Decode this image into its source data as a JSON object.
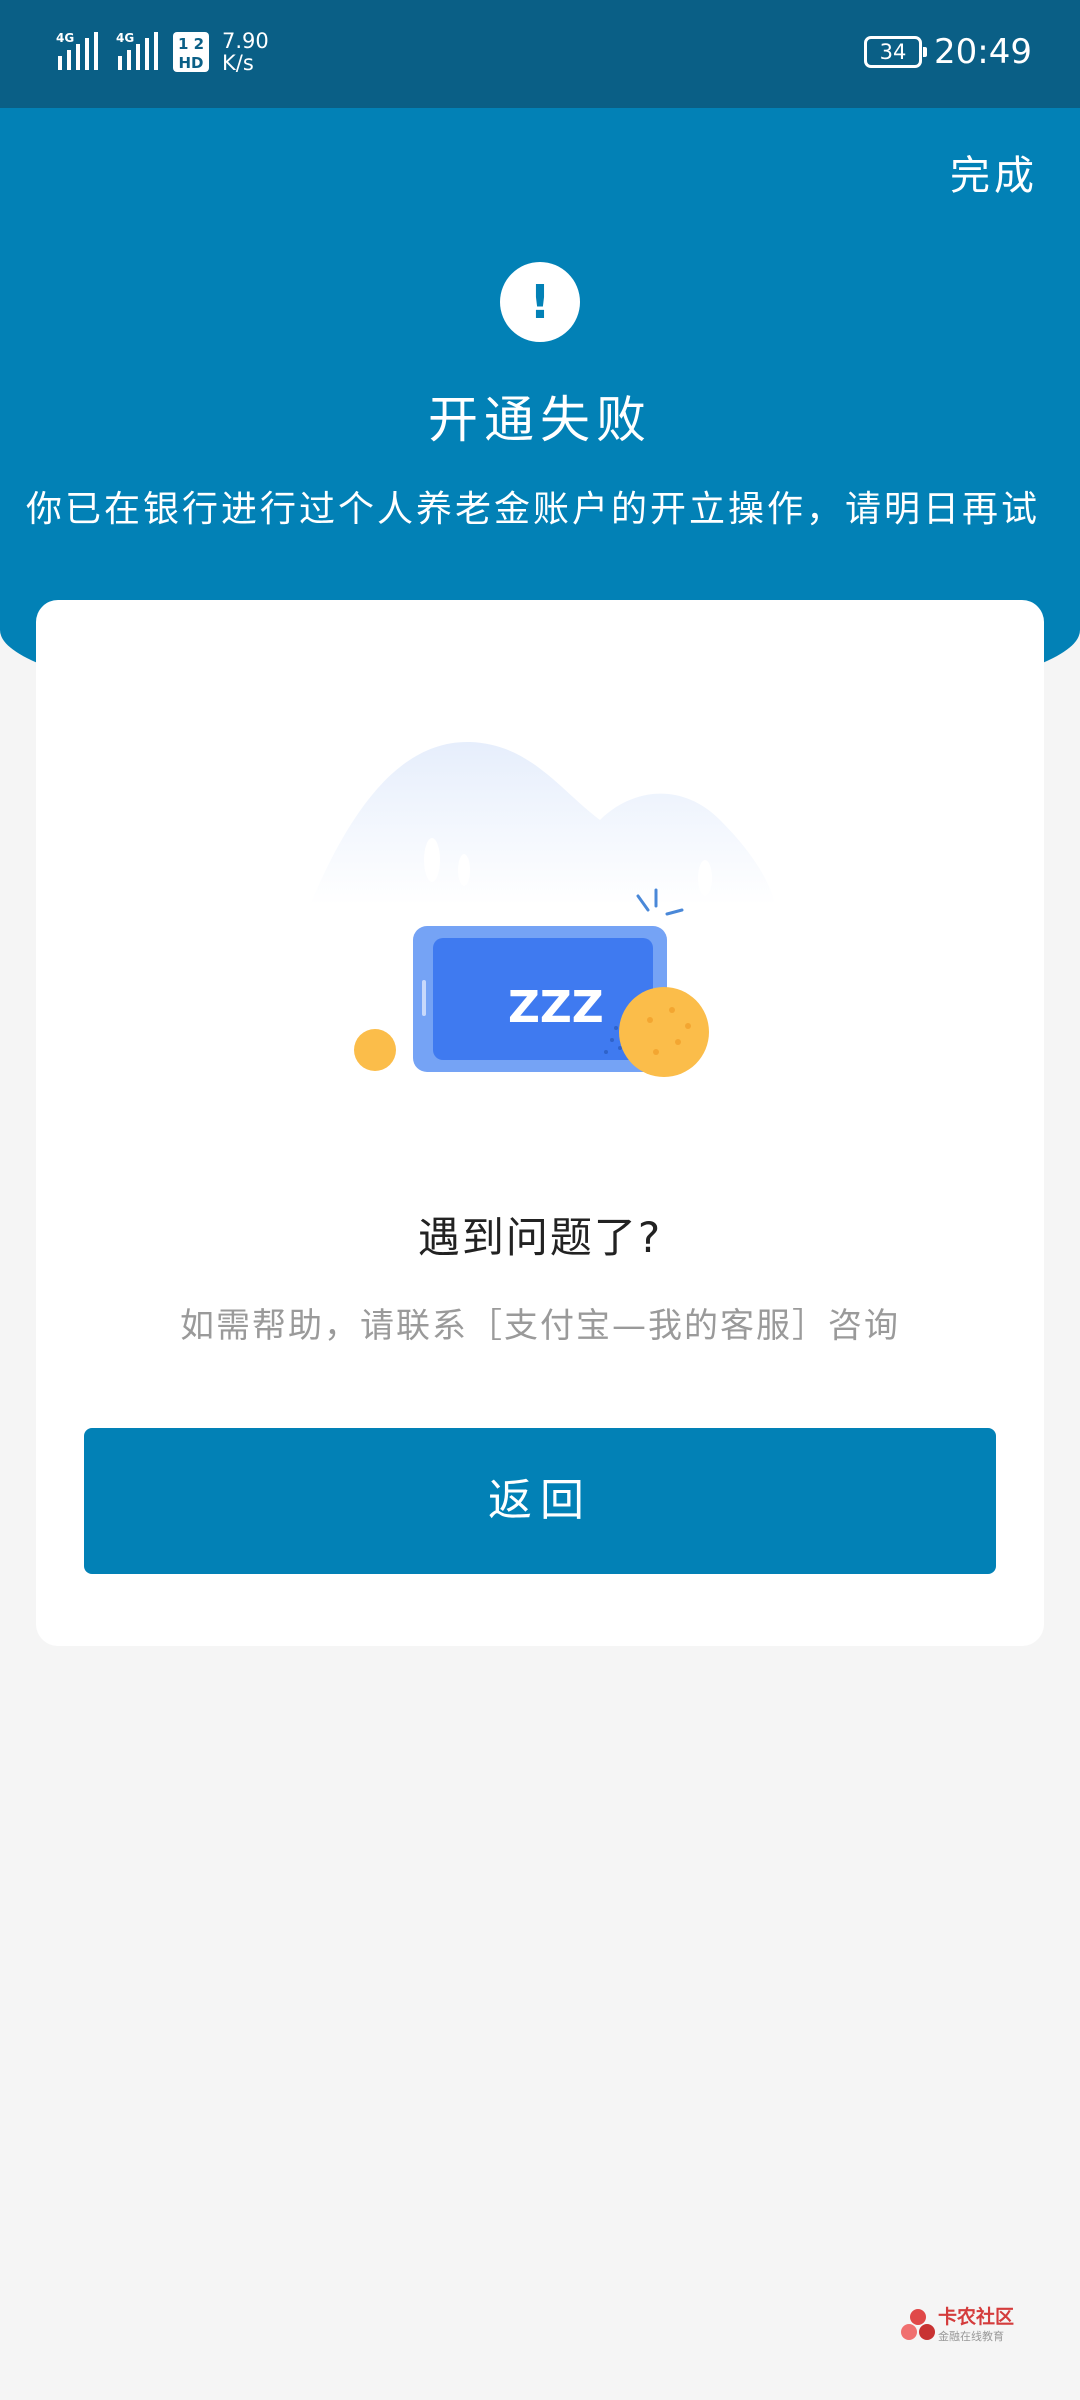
{
  "status_bar": {
    "signal_1_label": "4G",
    "signal_2_label": "4G",
    "hd_label_top": "1 2",
    "hd_label_bottom": "HD",
    "speed_value": "7.90",
    "speed_unit": "K/s",
    "battery": "34",
    "time": "20:49"
  },
  "header": {
    "done_label": "完成",
    "title": "开通失败",
    "message": "你已在银行进行过个人养老金账户的开立操作，请明日再试"
  },
  "card": {
    "help_title": "遇到问题了?",
    "help_text": "如需帮助，请联系［支付宝—我的客服］咨询",
    "return_label": "返回",
    "illustration_text": "ZZZ"
  },
  "watermark": {
    "name": "卡农社区",
    "sub": "金融在线教育"
  },
  "colors": {
    "primary": "#0281b6",
    "status_bar": "#0a5f86",
    "page_background": "#f5f5f5",
    "phone_screen": "#3f7af0",
    "coin": "#fbbd4a"
  }
}
